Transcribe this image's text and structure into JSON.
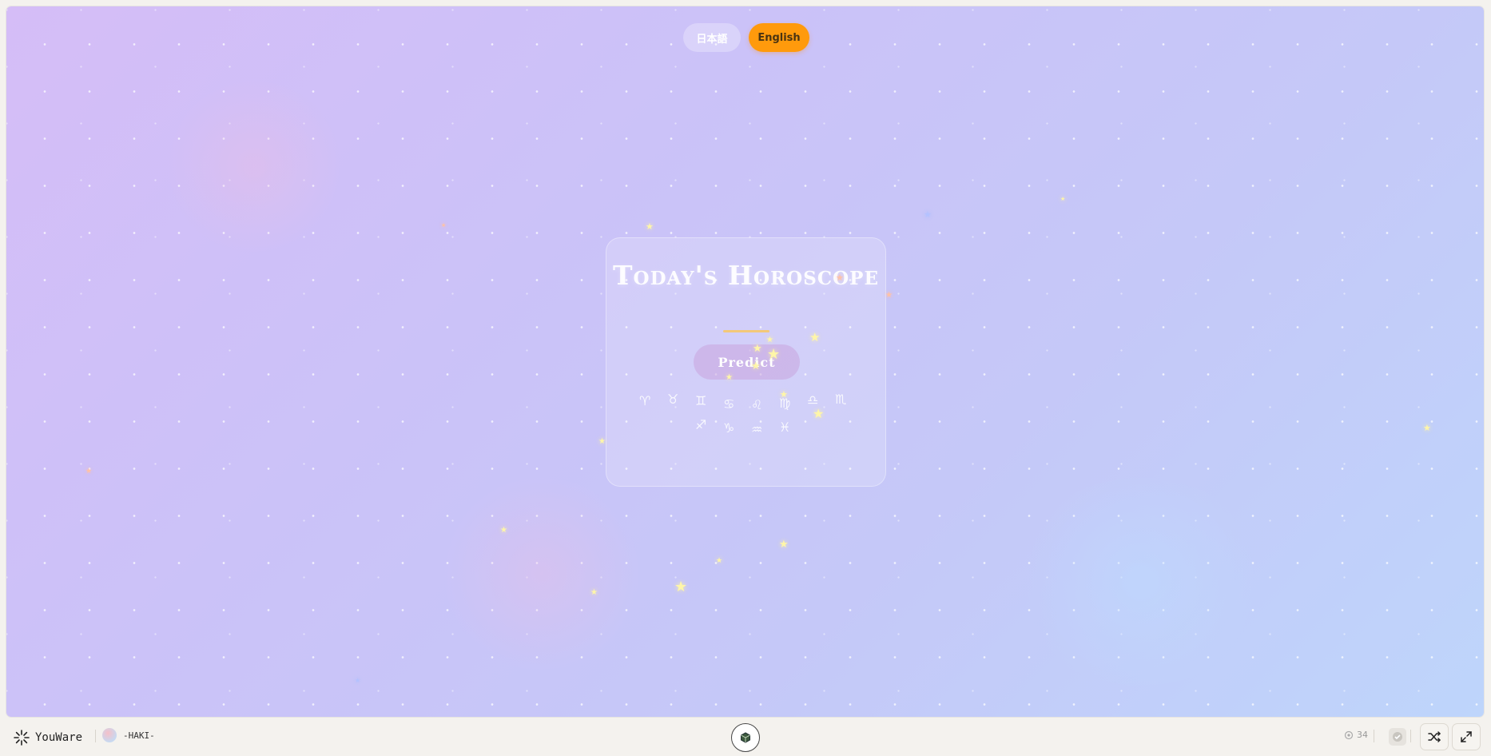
{
  "language_switch": {
    "japanese_label": "日本語",
    "english_label": "English"
  },
  "card": {
    "title": "Today's Horoscope",
    "predict_label": "Predict",
    "zodiac_row1": [
      "♈",
      "♉",
      "♊",
      "♋",
      "♌",
      "♍",
      "♎",
      "♏"
    ],
    "zodiac_row2": [
      "♐",
      "♑",
      "♒",
      "♓"
    ]
  },
  "footer": {
    "brand": "YouWare",
    "author": "-HAKI-",
    "views": "34"
  },
  "colors": {
    "english_button": "#ff9a0c",
    "title_underline": "#f3c879",
    "star": "#fff6a8"
  },
  "icons": [
    "youware-logo-icon",
    "box-icon",
    "eye-icon",
    "check-icon",
    "shuffle-icon",
    "expand-icon"
  ]
}
